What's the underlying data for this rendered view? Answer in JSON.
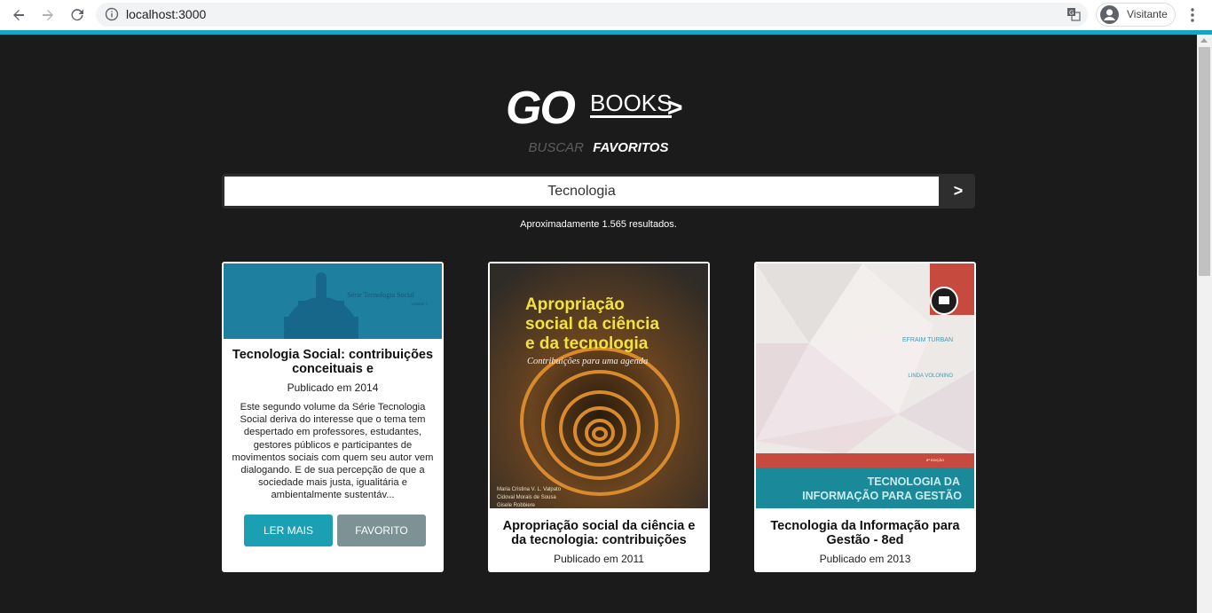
{
  "browser": {
    "url": "localhost:3000",
    "profile_name": "Visitante",
    "accent_color": "#19a5c0"
  },
  "logo": {
    "go": "GO",
    "books": "BOOKS",
    "arrow": ">"
  },
  "menu": {
    "buscar": "BUSCAR",
    "favoritos": "FAVORITOS"
  },
  "search": {
    "value": "Tecnologia",
    "button": ">"
  },
  "results_text": "Aproximadamente 1.565 resultados.",
  "books": [
    {
      "title": "Tecnologia Social: contribuições conceituais e",
      "published": "Publicado em 2014",
      "description": "Este segundo volume da Série Tecnologia Social deriva do interesse que o tema tem despertado em professores, estudantes, gestores públicos e participantes de movimentos sociais com quem seu autor vem dialogando. E de sua percepção de que a sociedade mais justa, igualitária e ambientalmente sustentáv...",
      "cover_text": "Série Tecnologia Social",
      "cover_subtext": "volume 2",
      "read_more": "LER MAIS",
      "favorite": "FAVORITO"
    },
    {
      "title": "Apropriação social da ciência e da tecnologia: contribuições",
      "published": "Publicado em 2011",
      "cover_title": "Apropriação social da ciência e da tecnologia",
      "cover_subtitle": "Contribuições para uma agenda",
      "cover_authors": [
        "Maria Cristina V. L. Valpato",
        "Cidoval Morais de Sousa",
        "Gisele Robbiere"
      ]
    },
    {
      "title": "Tecnologia da Informação para Gestão - 8ed",
      "published": "Publicado em 2013",
      "cover_author1": "EFRAIM TURBAN",
      "cover_author2": "LINDA VOLONINO",
      "cover_edition": "8ª EDIÇÃO",
      "cover_title": "TECNOLOGIA DA INFORMAÇÃO PARA GESTÃO"
    }
  ]
}
